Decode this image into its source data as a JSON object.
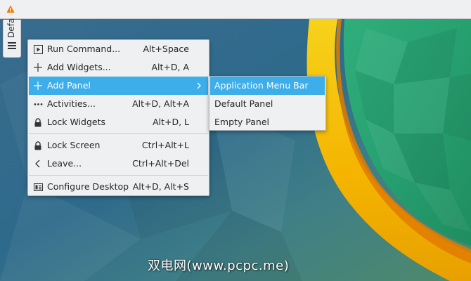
{
  "colors": {
    "accent": "#3daee9",
    "menu_bg": "#eff0f1",
    "panel_bg": "#eff0f1",
    "warning": "#f67400"
  },
  "toolbox": {
    "label": "Defa",
    "icon": "hamburger-icon"
  },
  "top_panel": {
    "icon": "warning-icon"
  },
  "context_menu": {
    "items": [
      {
        "label": "Run Command...",
        "shortcut": "Alt+Space",
        "icon": "run-command-icon"
      },
      {
        "label": "Add Widgets...",
        "shortcut": "Alt+D, A",
        "icon": "plus-icon"
      },
      {
        "label": "Add Panel",
        "shortcut": "",
        "icon": "plus-icon",
        "has_submenu": true,
        "selected": true
      },
      {
        "label": "Activities...",
        "shortcut": "Alt+D, Alt+A",
        "icon": "activities-icon"
      },
      {
        "label": "Lock Widgets",
        "shortcut": "Alt+D, L",
        "icon": "lock-icon"
      },
      {
        "label": "Lock Screen",
        "shortcut": "Ctrl+Alt+L",
        "icon": "lock-icon"
      },
      {
        "label": "Leave...",
        "shortcut": "Ctrl+Alt+Del",
        "icon": "chevron-left-icon"
      },
      {
        "label": "Configure Desktop",
        "shortcut": "Alt+D, Alt+S",
        "icon": "configure-icon"
      }
    ]
  },
  "submenu": {
    "items": [
      {
        "label": "Application Menu Bar",
        "selected": true
      },
      {
        "label": "Default Panel"
      },
      {
        "label": "Empty Panel"
      }
    ]
  },
  "watermark": "双电网(www.pcpc.me)"
}
